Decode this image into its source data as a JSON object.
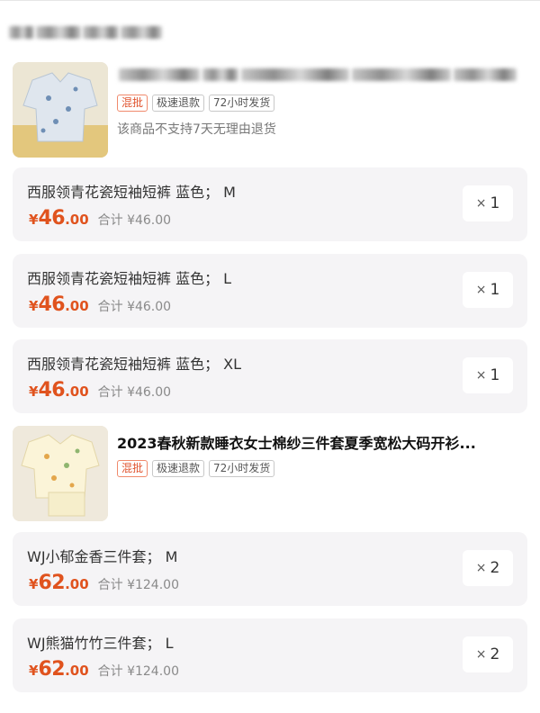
{
  "groups": [
    {
      "title": "",
      "tags": [
        "混批",
        "极速退款",
        "72小时发货"
      ],
      "notice": "该商品不支持7天无理由退货",
      "skus": [
        {
          "name": "西服领青花瓷短袖短裤 蓝色； M",
          "yen": "¥",
          "price_int": "46",
          "price_dec": ".00",
          "subtotal": "合计 ¥46.00",
          "qty_x": "×",
          "qty": "1"
        },
        {
          "name": "西服领青花瓷短袖短裤 蓝色； L",
          "yen": "¥",
          "price_int": "46",
          "price_dec": ".00",
          "subtotal": "合计 ¥46.00",
          "qty_x": "×",
          "qty": "1"
        },
        {
          "name": "西服领青花瓷短袖短裤 蓝色； XL",
          "yen": "¥",
          "price_int": "46",
          "price_dec": ".00",
          "subtotal": "合计 ¥46.00",
          "qty_x": "×",
          "qty": "1"
        }
      ]
    },
    {
      "title": "2023春秋新款睡衣女士棉纱三件套夏季宽松大码开衫...",
      "tags": [
        "混批",
        "极速退款",
        "72小时发货"
      ],
      "skus": [
        {
          "name": "WJ小郁金香三件套； M",
          "yen": "¥",
          "price_int": "62",
          "price_dec": ".00",
          "subtotal": "合计 ¥124.00",
          "qty_x": "×",
          "qty": "2"
        },
        {
          "name": "WJ熊猫竹竹三件套； L",
          "yen": "¥",
          "price_int": "62",
          "price_dec": ".00",
          "subtotal": "合计 ¥124.00",
          "qty_x": "×",
          "qty": "2"
        }
      ]
    }
  ],
  "colors": {
    "price": "#e0531e",
    "tag_hot": "#e0532e",
    "sku_bg": "#f5f4f6"
  }
}
